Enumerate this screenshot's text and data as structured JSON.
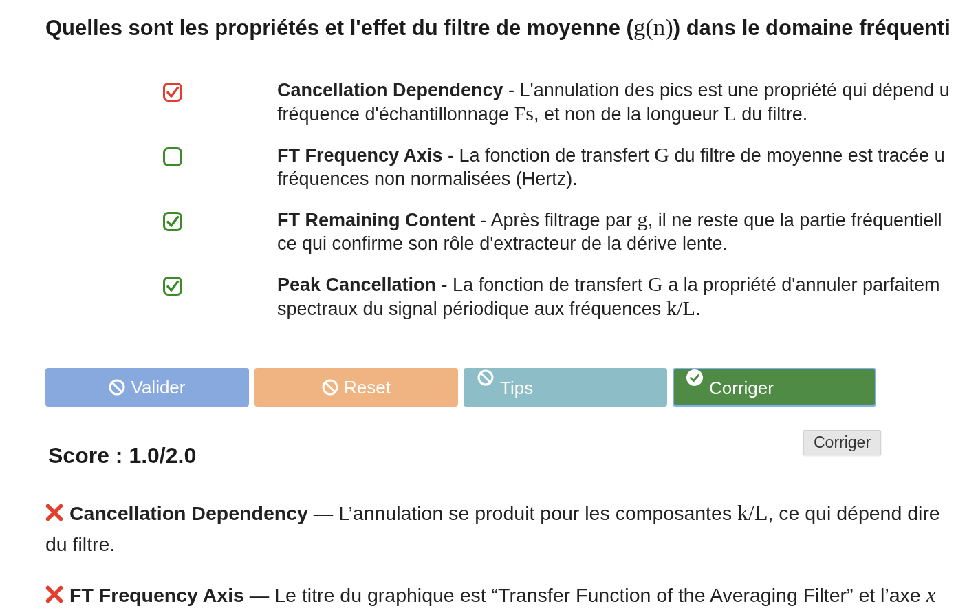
{
  "question": {
    "segments": [
      {
        "kind": "text",
        "text": "Quelles sont les propriétés et l'effet du filtre de moyenne ("
      },
      {
        "kind": "math",
        "text": "g(n)"
      },
      {
        "kind": "text",
        "text": ") dans le domaine fréquenti"
      }
    ]
  },
  "options": [
    {
      "label": "Cancellation Dependency",
      "checked": true,
      "color": "#e33b2e",
      "lines": [
        [
          {
            "kind": "text",
            "text": " - L'annulation des pics est une propriété qui dépend u"
          }
        ],
        [
          {
            "kind": "text",
            "text": "fréquence d'échantillonnage "
          },
          {
            "kind": "math",
            "text": "Fs"
          },
          {
            "kind": "text",
            "text": ", et non de la longueur "
          },
          {
            "kind": "math",
            "text": "L"
          },
          {
            "kind": "text",
            "text": " du filtre."
          }
        ]
      ]
    },
    {
      "label": "FT Frequency Axis",
      "checked": false,
      "color": "#3c8a2a",
      "lines": [
        [
          {
            "kind": "text",
            "text": " - La fonction de transfert "
          },
          {
            "kind": "math",
            "text": "G"
          },
          {
            "kind": "text",
            "text": " du filtre de moyenne est tracée u"
          }
        ],
        [
          {
            "kind": "text",
            "text": "fréquences non normalisées (Hertz)."
          }
        ]
      ]
    },
    {
      "label": "FT Remaining Content",
      "checked": true,
      "color": "#3c8a2a",
      "lines": [
        [
          {
            "kind": "text",
            "text": " - Après filtrage par "
          },
          {
            "kind": "math",
            "text": "g"
          },
          {
            "kind": "text",
            "text": ", il ne reste que la partie fréquentiell"
          }
        ],
        [
          {
            "kind": "text",
            "text": "ce qui confirme son rôle d'extracteur de la dérive lente."
          }
        ]
      ]
    },
    {
      "label": "Peak Cancellation",
      "checked": true,
      "color": "#3c8a2a",
      "lines": [
        [
          {
            "kind": "text",
            "text": " - La fonction de transfert "
          },
          {
            "kind": "math",
            "text": "G"
          },
          {
            "kind": "text",
            "text": " a la propriété d'annuler parfaitem"
          }
        ],
        [
          {
            "kind": "text",
            "text": "spectraux du signal périodique aux fréquences "
          },
          {
            "kind": "math",
            "text": "k/L"
          },
          {
            "kind": "text",
            "text": "."
          }
        ]
      ]
    }
  ],
  "buttons": [
    {
      "label": "Valider",
      "kind": "action",
      "disabled": true,
      "focused": false,
      "color": "#87a9dd"
    },
    {
      "label": "Reset",
      "kind": "action",
      "disabled": true,
      "focused": false,
      "color": "#f0b382"
    },
    {
      "label": "Tips",
      "kind": "toggle",
      "disabled": true,
      "focused": false,
      "color": "#8dbec8"
    },
    {
      "label": "Corriger",
      "kind": "toggle",
      "disabled": false,
      "focused": true,
      "color": "#4f8b45"
    }
  ],
  "tooltip": {
    "text": "Corriger"
  },
  "score": "Score : 1.0/2.0",
  "feedback": [
    {
      "correct": false,
      "label": "Cancellation Dependency",
      "lines": [
        [
          {
            "kind": "text",
            "text": " — L’annulation se produit pour les composantes "
          },
          {
            "kind": "math",
            "text": "k/L"
          },
          {
            "kind": "text",
            "text": ", ce qui dépend dire"
          }
        ],
        [
          {
            "kind": "text",
            "text": "du filtre."
          }
        ]
      ]
    },
    {
      "correct": false,
      "label": "FT Frequency Axis",
      "lines": [
        [
          {
            "kind": "text",
            "text": " — Le titre du graphique est “Transfer Function of the Averaging Filter” et l’axe "
          },
          {
            "kind": "var",
            "text": "x"
          }
        ]
      ]
    }
  ]
}
